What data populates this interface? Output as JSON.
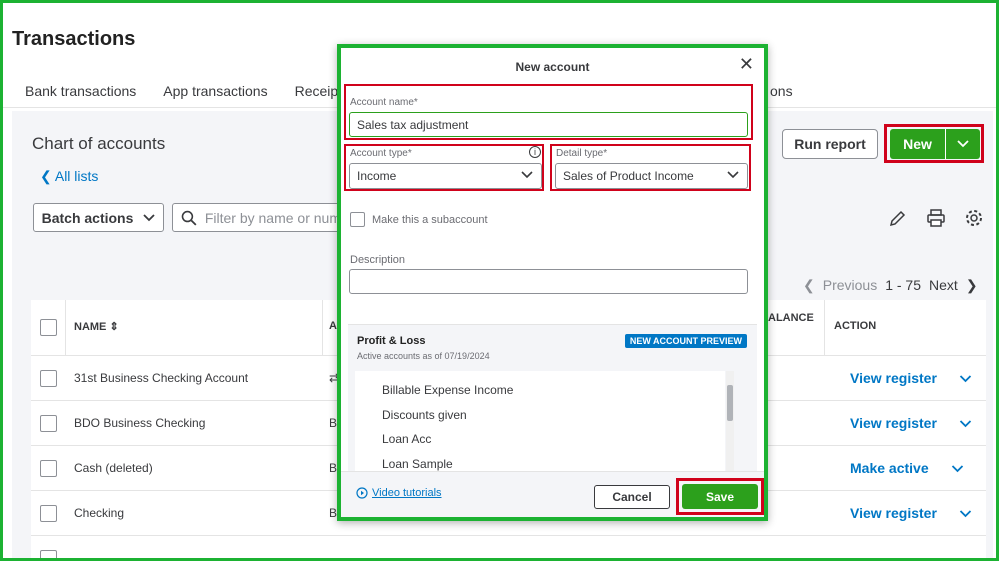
{
  "page": {
    "title": "Transactions"
  },
  "tabs": [
    "Bank transactions",
    "App transactions",
    "Receipts"
  ],
  "tab_tail": "ons",
  "coa": {
    "title": "Chart of accounts",
    "all_lists": "All lists",
    "batch_actions": "Batch actions",
    "filter_placeholder": "Filter by name or num",
    "run_report": "Run report",
    "new_label": "New"
  },
  "pager": {
    "previous": "Previous",
    "range": "1 - 75",
    "next": "Next"
  },
  "table": {
    "headers": {
      "name": "NAME",
      "type_partial": "A",
      "balance_partial": "ALANCE",
      "action": "ACTION"
    },
    "rows": [
      {
        "name": "31st Business Checking Account",
        "type": "",
        "action": "View register"
      },
      {
        "name": "BDO Business Checking",
        "type": "B",
        "action": "View register"
      },
      {
        "name": "Cash (deleted)",
        "type": "B",
        "action": "Make active"
      },
      {
        "name": "Checking",
        "type": "B",
        "action": "View register"
      }
    ]
  },
  "modal": {
    "title": "New account",
    "account_name_label": "Account name*",
    "account_name_value": "Sales tax adjustment",
    "account_type_label": "Account type*",
    "account_type_value": "Income",
    "detail_type_label": "Detail type*",
    "detail_type_value": "Sales of Product Income",
    "subaccount_label": "Make this a subaccount",
    "description_label": "Description",
    "preview": {
      "title": "Profit & Loss",
      "subtitle": "Active accounts as of 07/19/2024",
      "badge": "NEW ACCOUNT PREVIEW",
      "items": [
        "Billable Expense Income",
        "Discounts given",
        "Loan Acc",
        "Loan Sample"
      ]
    },
    "video_tutorials": "Video tutorials",
    "cancel": "Cancel",
    "save": "Save"
  },
  "colors": {
    "green": "#2ca01c",
    "highlight_green": "#1cb232",
    "highlight_red": "#d0021b",
    "link": "#0077c5"
  }
}
